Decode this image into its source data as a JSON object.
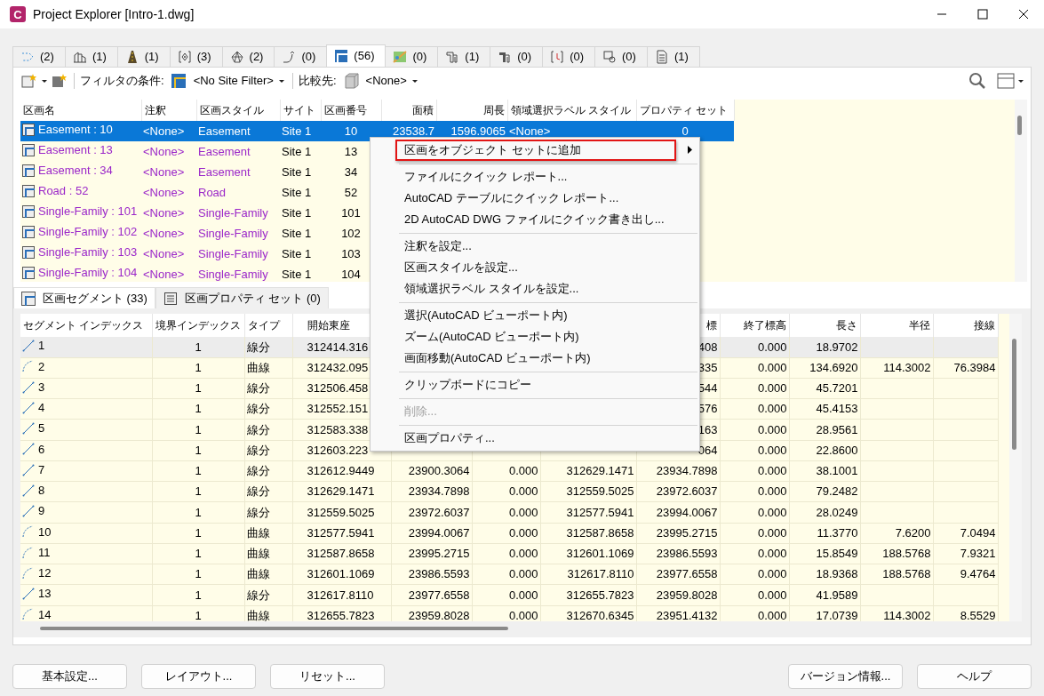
{
  "window": {
    "title": "Project Explorer [Intro-1.dwg]",
    "app_icon_letter": "C"
  },
  "object_tabs": [
    {
      "count": "(2)",
      "selected": false
    },
    {
      "count": "(1)",
      "selected": false
    },
    {
      "count": "(1)",
      "selected": false
    },
    {
      "count": "(3)",
      "selected": false
    },
    {
      "count": "(2)",
      "selected": false
    },
    {
      "count": "(0)",
      "selected": false
    },
    {
      "count": "(56)",
      "selected": true
    },
    {
      "count": "(0)",
      "selected": false
    },
    {
      "count": "(1)",
      "selected": false
    },
    {
      "count": "(0)",
      "selected": false
    },
    {
      "count": "(0)",
      "selected": false
    },
    {
      "count": "(0)",
      "selected": false
    },
    {
      "count": "(1)",
      "selected": false
    }
  ],
  "toolbar": {
    "filter_label": "フィルタの条件:",
    "site_filter": "<No Site Filter>",
    "compare_label": "比較先:",
    "compare_value": "<None>"
  },
  "parcels": {
    "columns": [
      "区画名",
      "注釈",
      "区画スタイル",
      "サイト",
      "区画番号",
      "面積",
      "周長",
      "領域選択ラベル スタイル",
      "プロパティ セット"
    ],
    "rows": [
      {
        "selected": true,
        "cells": [
          "Easement : 10",
          "<None>",
          "Easement",
          "Site 1",
          "10",
          "23538.7",
          "1596.9065",
          "<None>",
          "0"
        ]
      },
      {
        "selected": false,
        "cells": [
          "Easement : 13",
          "<None>",
          "Easement",
          "Site 1",
          "13"
        ]
      },
      {
        "selected": false,
        "cells": [
          "Easement : 34",
          "<None>",
          "Easement",
          "Site 1",
          "34"
        ]
      },
      {
        "selected": false,
        "cells": [
          "Road : 52",
          "<None>",
          "Road",
          "Site 1",
          "52"
        ]
      },
      {
        "selected": false,
        "cells": [
          "Single-Family : 101",
          "<None>",
          "Single-Family",
          "Site 1",
          "101"
        ]
      },
      {
        "selected": false,
        "cells": [
          "Single-Family : 102",
          "<None>",
          "Single-Family",
          "Site 1",
          "102"
        ]
      },
      {
        "selected": false,
        "cells": [
          "Single-Family : 103",
          "<None>",
          "Single-Family",
          "Site 1",
          "103"
        ]
      },
      {
        "selected": false,
        "cells": [
          "Single-Family : 104",
          "<None>",
          "Single-Family",
          "Site 1",
          "104"
        ]
      }
    ]
  },
  "segment_tabs": [
    {
      "label": "区画セグメント (33)",
      "selected": true
    },
    {
      "label": "区画プロパティ セット (0)",
      "selected": false
    }
  ],
  "segments": {
    "columns": [
      "セグメント インデックス",
      "境界インデックス",
      "タイプ",
      "開始東座",
      null,
      null,
      null,
      "標",
      "終了標高",
      "長さ",
      "半径",
      "接線"
    ],
    "rows": [
      {
        "selected": true,
        "kind": "line",
        "cells": [
          "1",
          "1",
          "線分",
          "312414.316",
          null,
          null,
          null,
          "408",
          "0.000",
          "18.9702",
          null,
          null
        ]
      },
      {
        "selected": false,
        "kind": "arc",
        "cells": [
          "2",
          "1",
          "曲線",
          "312432.095",
          null,
          null,
          null,
          "335",
          "0.000",
          "134.6920",
          "114.3002",
          "76.3984"
        ]
      },
      {
        "selected": false,
        "kind": "line",
        "cells": [
          "3",
          "1",
          "線分",
          "312506.458",
          null,
          null,
          null,
          "544",
          "0.000",
          "45.7201",
          null,
          null
        ]
      },
      {
        "selected": false,
        "kind": "line",
        "cells": [
          "4",
          "1",
          "線分",
          "312552.151",
          null,
          null,
          null,
          "576",
          "0.000",
          "45.4153",
          null,
          null
        ]
      },
      {
        "selected": false,
        "kind": "line",
        "cells": [
          "5",
          "1",
          "線分",
          "312583.338",
          null,
          null,
          null,
          "163",
          "0.000",
          "28.9561",
          null,
          null
        ]
      },
      {
        "selected": false,
        "kind": "line",
        "cells": [
          "6",
          "1",
          "線分",
          "312603.223",
          null,
          null,
          null,
          "064",
          "0.000",
          "22.8600",
          null,
          null
        ]
      },
      {
        "selected": false,
        "kind": "line",
        "cells": [
          "7",
          "1",
          "線分",
          "312612.9449",
          "23900.3064",
          "0.000",
          "312629.1471",
          "23934.7898",
          "0.000",
          "38.1001",
          null,
          null
        ]
      },
      {
        "selected": false,
        "kind": "line",
        "cells": [
          "8",
          "1",
          "線分",
          "312629.1471",
          "23934.7898",
          "0.000",
          "312559.5025",
          "23972.6037",
          "0.000",
          "79.2482",
          null,
          null
        ]
      },
      {
        "selected": false,
        "kind": "line",
        "cells": [
          "9",
          "1",
          "線分",
          "312559.5025",
          "23972.6037",
          "0.000",
          "312577.5941",
          "23994.0067",
          "0.000",
          "28.0249",
          null,
          null
        ]
      },
      {
        "selected": false,
        "kind": "arc",
        "cells": [
          "10",
          "1",
          "曲線",
          "312577.5941",
          "23994.0067",
          "0.000",
          "312587.8658",
          "23995.2715",
          "0.000",
          "11.3770",
          "7.6200",
          "7.0494"
        ]
      },
      {
        "selected": false,
        "kind": "arc",
        "cells": [
          "11",
          "1",
          "曲線",
          "312587.8658",
          "23995.2715",
          "0.000",
          "312601.1069",
          "23986.5593",
          "0.000",
          "15.8549",
          "188.5768",
          "7.9321"
        ]
      },
      {
        "selected": false,
        "kind": "arc",
        "cells": [
          "12",
          "1",
          "曲線",
          "312601.1069",
          "23986.5593",
          "0.000",
          "312617.8110",
          "23977.6558",
          "0.000",
          "18.9368",
          "188.5768",
          "9.4764"
        ]
      },
      {
        "selected": false,
        "kind": "line",
        "cells": [
          "13",
          "1",
          "線分",
          "312617.8110",
          "23977.6558",
          "0.000",
          "312655.7823",
          "23959.8028",
          "0.000",
          "41.9589",
          null,
          null
        ]
      },
      {
        "selected": false,
        "kind": "arc",
        "cells": [
          "14",
          "1",
          "曲線",
          "312655.7823",
          "23959.8028",
          "0.000",
          "312670.6345",
          "23951.4132",
          "0.000",
          "17.0739",
          "114.3002",
          "8.5529"
        ]
      }
    ]
  },
  "context_menu": {
    "groups": [
      [
        {
          "label": "区画をオブジェクト セットに追加",
          "submenu": true,
          "highlighted": true,
          "disabled": false
        }
      ],
      [
        {
          "label": "ファイルにクイック レポート...",
          "submenu": false,
          "highlighted": false,
          "disabled": false
        },
        {
          "label": "AutoCAD テーブルにクイック レポート...",
          "submenu": false,
          "highlighted": false,
          "disabled": false
        },
        {
          "label": "2D AutoCAD DWG ファイルにクイック書き出し...",
          "submenu": false,
          "highlighted": false,
          "disabled": false
        }
      ],
      [
        {
          "label": "注釈を設定...",
          "submenu": false,
          "highlighted": false,
          "disabled": false
        },
        {
          "label": "区画スタイルを設定...",
          "submenu": false,
          "highlighted": false,
          "disabled": false
        },
        {
          "label": "領域選択ラベル スタイルを設定...",
          "submenu": false,
          "highlighted": false,
          "disabled": false
        }
      ],
      [
        {
          "label": "選択(AutoCAD ビューポート内)",
          "submenu": false,
          "highlighted": false,
          "disabled": false
        },
        {
          "label": "ズーム(AutoCAD ビューポート内)",
          "submenu": false,
          "highlighted": false,
          "disabled": false
        },
        {
          "label": "画面移動(AutoCAD ビューポート内)",
          "submenu": false,
          "highlighted": false,
          "disabled": false
        }
      ],
      [
        {
          "label": "クリップボードにコピー",
          "submenu": false,
          "highlighted": false,
          "disabled": false
        }
      ],
      [
        {
          "label": "削除...",
          "submenu": false,
          "highlighted": false,
          "disabled": true
        }
      ],
      [
        {
          "label": "区画プロパティ...",
          "submenu": false,
          "highlighted": false,
          "disabled": false
        }
      ]
    ]
  },
  "buttons_left": [
    "基本設定...",
    "レイアウト...",
    "リセット..."
  ],
  "buttons_right": [
    "バージョン情報...",
    "ヘルプ"
  ]
}
